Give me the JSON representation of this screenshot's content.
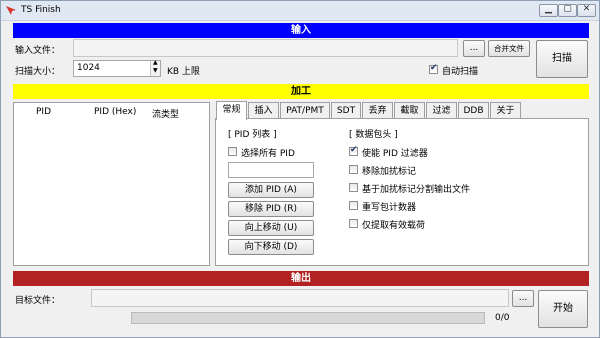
{
  "window": {
    "title": "TS Finish"
  },
  "controls": {
    "minimize": "▁",
    "maximize": "▢",
    "close": "✕"
  },
  "input_section": {
    "banner": "输入",
    "input_file_label": "输入文件：",
    "input_file_value": "",
    "browse_label": "...",
    "merge_label": "合并文件",
    "scan_label": "扫描",
    "scan_size_label": "扫描大小：",
    "scan_size_value": "1024",
    "scan_size_unit": "KB 上限",
    "auto_scan_label": "自动扫描",
    "auto_scan_checked": true
  },
  "process_section": {
    "banner": "加工",
    "columns": [
      "PID",
      "PID (Hex)",
      "流类型"
    ],
    "rows": [],
    "tabs": [
      "常规",
      "插入",
      "PAT/PMT",
      "SDT",
      "丢弃",
      "截取",
      "过滤",
      "DDB",
      "关于"
    ],
    "active_tab": 0,
    "general": {
      "pid_list_title": "[ PID 列表 ]",
      "select_all_label": "选择所有 PID",
      "select_all_checked": false,
      "pid_input_value": "",
      "add_pid": "添加 PID (A)",
      "remove_pid": "移除 PID (R)",
      "move_up": "向上移动 (U)",
      "move_down": "向下移动 (D)",
      "packet_header_title": "[ 数据包头 ]",
      "options": [
        {
          "label": "使能 PID 过滤器",
          "checked": true
        },
        {
          "label": "移除加扰标记",
          "checked": false
        },
        {
          "label": "基于加扰标记分割输出文件",
          "checked": false
        },
        {
          "label": "重写包计数器",
          "checked": false
        },
        {
          "label": "仅提取有效载荷",
          "checked": false
        }
      ]
    }
  },
  "output_section": {
    "banner": "输出",
    "target_file_label": "目标文件：",
    "target_file_value": "",
    "browse_label": "...",
    "start_label": "开始",
    "progress_text": "0/0",
    "progress": 0
  }
}
